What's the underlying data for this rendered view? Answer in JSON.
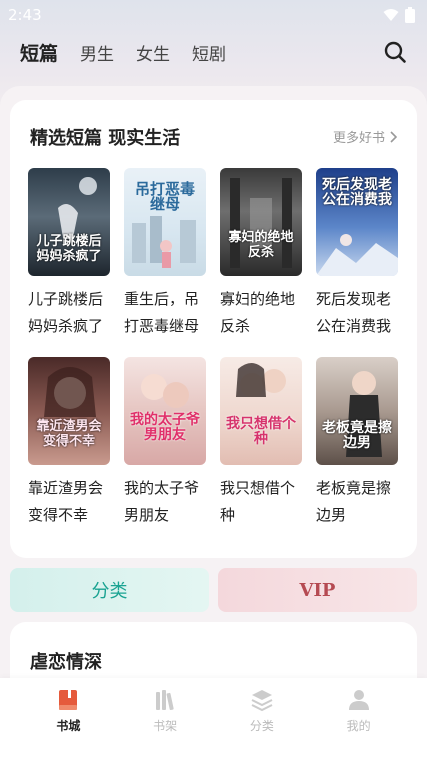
{
  "status_bar": {
    "time": "2:43"
  },
  "tabs": [
    {
      "label": "短篇",
      "active": true
    },
    {
      "label": "男生",
      "active": false
    },
    {
      "label": "女生",
      "active": false
    },
    {
      "label": "短剧",
      "active": false
    }
  ],
  "section": {
    "title": "精选短篇 现实生活",
    "more_label": "更多好书",
    "books": [
      {
        "title": "儿子跳楼后妈妈杀疯了",
        "cover_text": "儿子跳楼后妈妈杀疯了"
      },
      {
        "title": "重生后，吊打恶毒继母",
        "cover_text": "吊打恶毒继母"
      },
      {
        "title": "寡妇的绝地反杀",
        "cover_text": "寡妇的绝地反杀"
      },
      {
        "title": "死后发现老公在消费我",
        "cover_text": "死后发现老公在消费我"
      },
      {
        "title": "靠近渣男会变得不幸",
        "cover_text": "靠近渣男会变得不幸"
      },
      {
        "title": "我的太子爷男朋友",
        "cover_text": "我的太子爷男朋友"
      },
      {
        "title": "我只想借个种",
        "cover_text": "我只想借个种"
      },
      {
        "title": "老板竟是擦边男",
        "cover_text": "老板竟是擦边男"
      }
    ]
  },
  "quick_links": {
    "category": "分类",
    "vip": "VIP"
  },
  "section2": {
    "title": "虐恋情深"
  },
  "bottom_nav": [
    {
      "label": "书城",
      "icon": "book-icon",
      "active": true
    },
    {
      "label": "书架",
      "icon": "bookshelf-icon",
      "active": false
    },
    {
      "label": "分类",
      "icon": "layers-icon",
      "active": false
    },
    {
      "label": "我的",
      "icon": "user-icon",
      "active": false
    }
  ],
  "colors": {
    "accent": "#e55a3c",
    "category_text": "#1aa392",
    "vip_text": "#b54a52"
  }
}
